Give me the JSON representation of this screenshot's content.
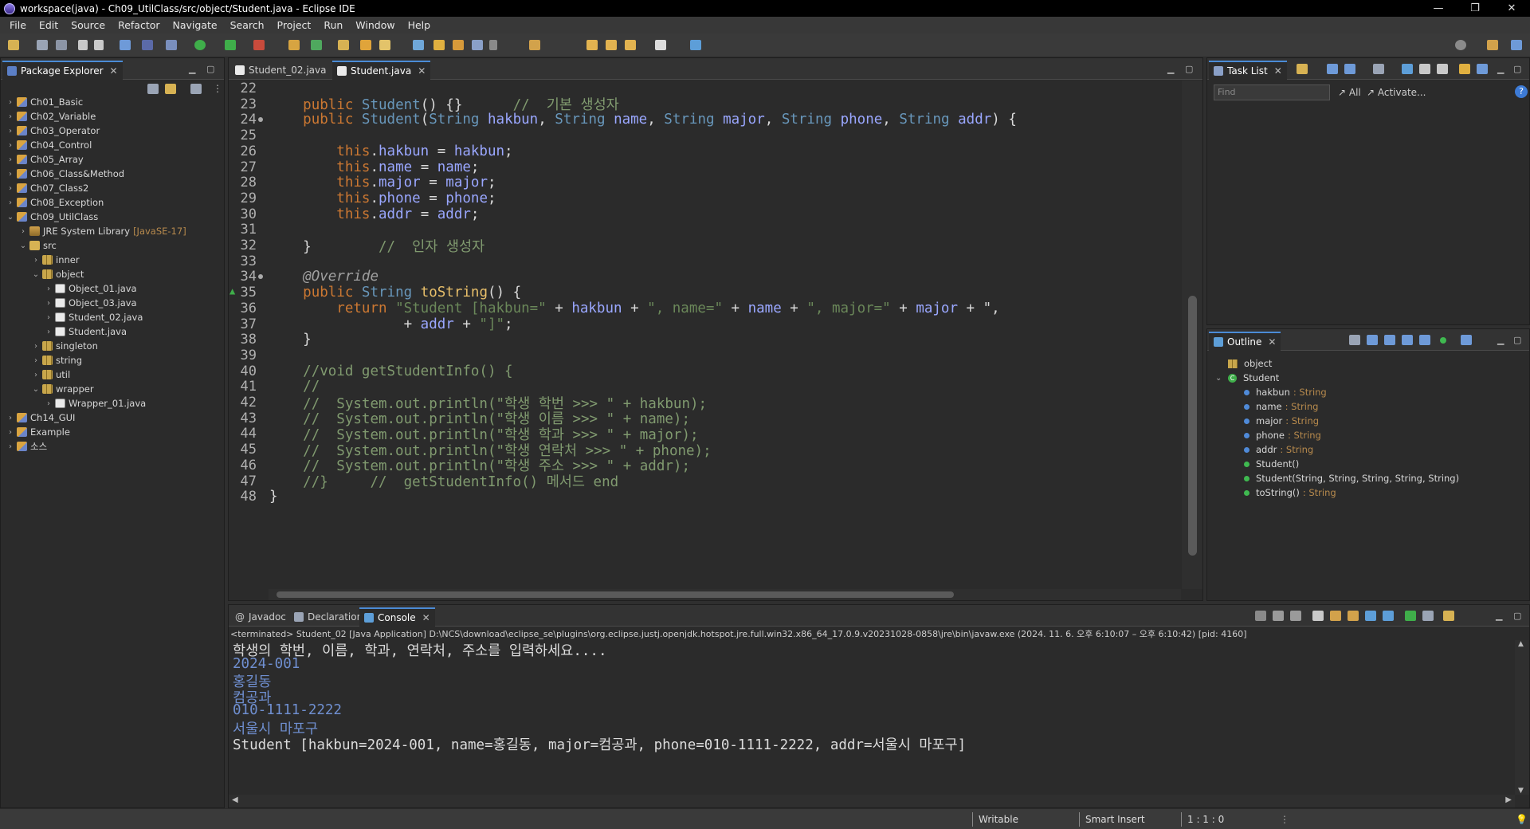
{
  "window": {
    "title": "workspace(java) - Ch09_UtilClass/src/object/Student.java - Eclipse IDE",
    "minimize": "—",
    "restore": "❐",
    "close": "✕"
  },
  "menu": [
    "File",
    "Edit",
    "Source",
    "Refactor",
    "Navigate",
    "Search",
    "Project",
    "Run",
    "Window",
    "Help"
  ],
  "package_explorer": {
    "tab_label": "Package Explorer",
    "items": [
      {
        "label": "Ch01_Basic",
        "icon": "project-icon"
      },
      {
        "label": "Ch02_Variable",
        "icon": "project-icon"
      },
      {
        "label": "Ch03_Operator",
        "icon": "project-icon"
      },
      {
        "label": "Ch04_Control",
        "icon": "project-icon"
      },
      {
        "label": "Ch05_Array",
        "icon": "project-icon"
      },
      {
        "label": "Ch06_Class&Method",
        "icon": "project-icon"
      },
      {
        "label": "Ch07_Class2",
        "icon": "project-icon"
      },
      {
        "label": "Ch08_Exception",
        "icon": "project-icon"
      },
      {
        "label": "Ch09_UtilClass",
        "icon": "project-icon"
      },
      {
        "label": "JRE System Library",
        "suffix": "[JavaSE-17]",
        "icon": "library-icon"
      },
      {
        "label": "src",
        "icon": "folder-icon"
      },
      {
        "label": "inner",
        "icon": "package-icon"
      },
      {
        "label": "object",
        "icon": "package-icon"
      },
      {
        "label": "Object_01.java",
        "icon": "java-file-icon"
      },
      {
        "label": "Object_03.java",
        "icon": "java-file-icon"
      },
      {
        "label": "Student_02.java",
        "icon": "java-file-icon"
      },
      {
        "label": "Student.java",
        "icon": "java-file-icon"
      },
      {
        "label": "singleton",
        "icon": "package-icon"
      },
      {
        "label": "string",
        "icon": "package-icon"
      },
      {
        "label": "util",
        "icon": "package-icon"
      },
      {
        "label": "wrapper",
        "icon": "package-icon"
      },
      {
        "label": "Wrapper_01.java",
        "icon": "java-file-icon"
      },
      {
        "label": "Ch14_GUI",
        "icon": "project-icon"
      },
      {
        "label": "Example",
        "icon": "project-icon"
      },
      {
        "label": "소스",
        "icon": "project-icon"
      }
    ]
  },
  "editor": {
    "tabs": [
      "Student_02.java",
      "Student.java"
    ],
    "active_tab": "Student.java",
    "lines": [
      {
        "n": "22",
        "text": ""
      },
      {
        "n": "23",
        "text": "    public Student() {}      //  기본 생성자"
      },
      {
        "n": "24●",
        "text": "    public Student(String hakbun, String name, String major, String phone, String addr) {"
      },
      {
        "n": "25",
        "text": ""
      },
      {
        "n": "26",
        "text": "        this.hakbun = hakbun;"
      },
      {
        "n": "27",
        "text": "        this.name = name;"
      },
      {
        "n": "28",
        "text": "        this.major = major;"
      },
      {
        "n": "29",
        "text": "        this.phone = phone;"
      },
      {
        "n": "30",
        "text": "        this.addr = addr;"
      },
      {
        "n": "31",
        "text": ""
      },
      {
        "n": "32",
        "text": "    }        //  인자 생성자"
      },
      {
        "n": "33",
        "text": ""
      },
      {
        "n": "34●",
        "text": "    @Override"
      },
      {
        "n": "35",
        "text": "    public String toString() {"
      },
      {
        "n": "36",
        "text": "        return \"Student [hakbun=\" + hakbun + \", name=\" + name + \", major=\" + major + \","
      },
      {
        "n": "37",
        "text": "                + addr + \"]\";"
      },
      {
        "n": "38",
        "text": "    }"
      },
      {
        "n": "39",
        "text": ""
      },
      {
        "n": "40",
        "text": "    //void getStudentInfo() {"
      },
      {
        "n": "41",
        "text": "    //"
      },
      {
        "n": "42",
        "text": "    //  System.out.println(\"학생 학번 >>> \" + hakbun);"
      },
      {
        "n": "43",
        "text": "    //  System.out.println(\"학생 이름 >>> \" + name);"
      },
      {
        "n": "44",
        "text": "    //  System.out.println(\"학생 학과 >>> \" + major);"
      },
      {
        "n": "45",
        "text": "    //  System.out.println(\"학생 연락처 >>> \" + phone);"
      },
      {
        "n": "46",
        "text": "    //  System.out.println(\"학생 주소 >>> \" + addr);"
      },
      {
        "n": "47",
        "text": "    //}     //  getStudentInfo() 메서드 end"
      },
      {
        "n": "48",
        "text": "}"
      }
    ]
  },
  "task_list": {
    "tab_label": "Task List",
    "find_placeholder": "Find",
    "all_label": "All",
    "activate_label": "Activate..."
  },
  "outline": {
    "tab_label": "Outline",
    "package": "object",
    "class": "Student",
    "members": [
      {
        "name": "hakbun",
        "type": ": String",
        "color": "#4f8ad8"
      },
      {
        "name": "name",
        "type": ": String",
        "color": "#4f8ad8"
      },
      {
        "name": "major",
        "type": ": String",
        "color": "#4f8ad8"
      },
      {
        "name": "phone",
        "type": ": String",
        "color": "#4f8ad8"
      },
      {
        "name": "addr",
        "type": ": String",
        "color": "#4f8ad8"
      },
      {
        "name": "Student()",
        "type": "",
        "color": "#3fb950"
      },
      {
        "name": "Student(String, String, String, String, String)",
        "type": "",
        "color": "#3fb950"
      },
      {
        "name": "toString()",
        "type": ": String",
        "color": "#3fb950"
      }
    ]
  },
  "bottom": {
    "tabs": [
      "Javadoc",
      "Declaration",
      "Console"
    ],
    "active_tab": "Console",
    "terminated": "<terminated> Student_02 [Java Application] D:\\NCS\\download\\eclipse_se\\plugins\\org.eclipse.justj.openjdk.hotspot.jre.full.win32.x86_64_17.0.9.v20231028-0858\\jre\\bin\\javaw.exe  (2024. 11. 6. 오후 6:10:07 – 오후 6:10:42) [pid: 4160]",
    "output": [
      {
        "text": "학생의 학번, 이름, 학과, 연락처, 주소를 입력하세요....",
        "color": "#dcdcdc"
      },
      {
        "text": "2024-001",
        "color": "#6f8fd0"
      },
      {
        "text": "홍길동",
        "color": "#6f8fd0"
      },
      {
        "text": "컴공과",
        "color": "#6f8fd0"
      },
      {
        "text": "010-1111-2222",
        "color": "#6f8fd0"
      },
      {
        "text": "서울시 마포구",
        "color": "#6f8fd0"
      },
      {
        "text": "Student [hakbun=2024-001, name=홍길동, major=컴공과, phone=010-1111-2222, addr=서울시 마포구]",
        "color": "#dcdcdc"
      }
    ]
  },
  "status": {
    "writable": "Writable",
    "insert_mode": "Smart Insert",
    "position": "1 : 1 : 0"
  },
  "colors": {
    "accent": "#4b8bd6",
    "editor_bg": "#2b2b2b",
    "keyword": "#cc7832",
    "comment": "#809a6f"
  }
}
